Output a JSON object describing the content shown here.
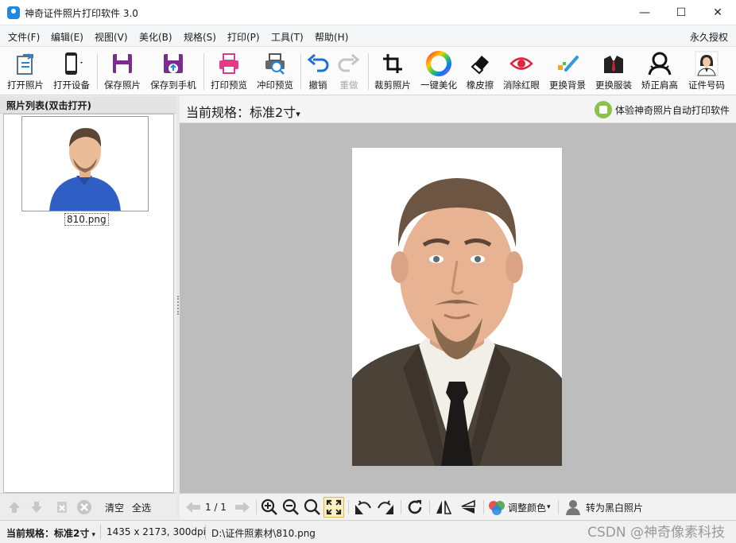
{
  "window": {
    "title": "神奇证件照片打印软件 3.0",
    "minimize": "—",
    "maximize": "☐",
    "close": "✕"
  },
  "menu": {
    "items": [
      "文件(F)",
      "编辑(E)",
      "视图(V)",
      "美化(B)",
      "规格(S)",
      "打印(P)",
      "工具(T)",
      "帮助(H)"
    ],
    "license": "永久授权"
  },
  "toolbar": {
    "open_photo": "打开照片",
    "open_device": "打开设备",
    "save_photo": "保存照片",
    "save_to_phone": "保存到手机",
    "print_preview": "打印预览",
    "develop_preview": "冲印预览",
    "undo": "撤销",
    "redo": "重做",
    "crop": "裁剪照片",
    "beautify": "一键美化",
    "eraser": "橡皮擦",
    "redeye": "消除红眼",
    "change_bg": "更换背景",
    "change_clothes": "更换服装",
    "fix_shoulder": "矫正肩高",
    "id_number": "证件号码"
  },
  "left_panel": {
    "header": "照片列表(双击打开)",
    "thumbnail_name": "810.png",
    "clear": "清空",
    "select_all": "全选"
  },
  "spec_bar": {
    "label": "当前规格：标准2寸",
    "dropdown_icon": "▾",
    "promo": "体验神奇照片自动打印软件"
  },
  "bottom_bar": {
    "page": "1 / 1",
    "adjust_color": "调整颜色",
    "to_bw": "转为黑白照片"
  },
  "status": {
    "spec_label": "当前规格：",
    "spec_value": "标准2寸",
    "dims": "1435 x 2173, 300dpi",
    "path": "D:\\证件照素材\\810.png",
    "watermark": "CSDN @神奇像素科技"
  },
  "colors": {
    "accent": "#1e88e5",
    "canvas_bg": "#bdbdbd",
    "shirt_blue": "#2f5fc4",
    "suit_brown": "#4b4238"
  }
}
